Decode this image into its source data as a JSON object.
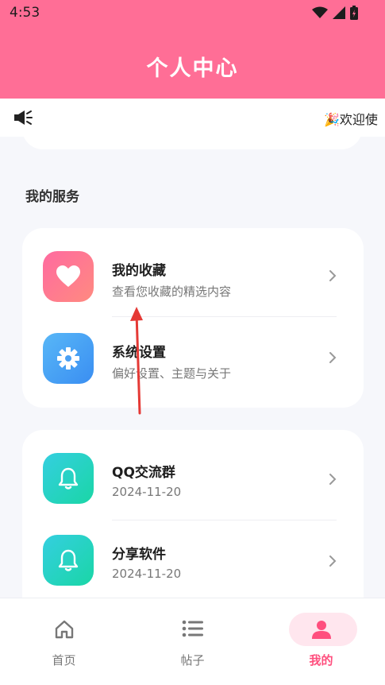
{
  "status_bar": {
    "time": "4:53"
  },
  "header": {
    "title": "个人中心"
  },
  "notice": {
    "text": "🎉欢迎使"
  },
  "section": {
    "title": "我的服务"
  },
  "services": [
    {
      "title": "我的收藏",
      "subtitle": "查看您收藏的精选内容",
      "icon": "heart-icon"
    },
    {
      "title": "系统设置",
      "subtitle": "偏好设置、主题与关于",
      "icon": "gear-icon"
    }
  ],
  "groups": [
    {
      "title": "QQ交流群",
      "date": "2024-11-20",
      "icon": "bell-icon"
    },
    {
      "title": "分享软件",
      "date": "2024-11-20",
      "icon": "bell-icon"
    }
  ],
  "nav": [
    {
      "label": "首页",
      "icon": "home-icon"
    },
    {
      "label": "帖子",
      "icon": "list-icon"
    },
    {
      "label": "我的",
      "icon": "person-icon",
      "active": true
    }
  ],
  "colors": {
    "brand": "#ff6e96",
    "active": "#ff4f7e",
    "annotation": "#e53935"
  }
}
